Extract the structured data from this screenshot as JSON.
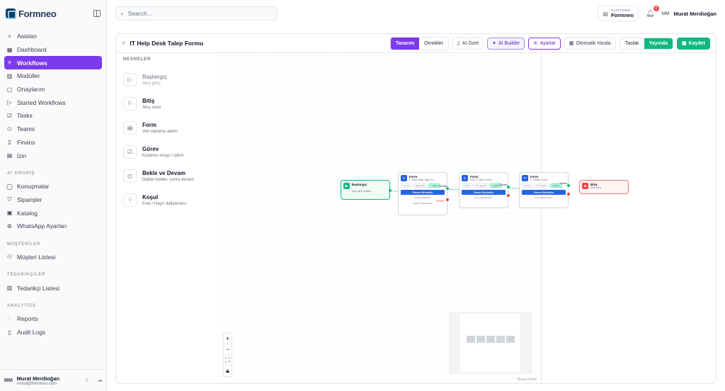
{
  "brand": {
    "name": "Formneo"
  },
  "sidebar": {
    "items": [
      {
        "label": "Asistan",
        "icon": "sparkle-icon"
      },
      {
        "label": "Dashboard",
        "icon": "grid-icon"
      },
      {
        "label": "Workflows",
        "icon": "workflow-icon",
        "active": true
      },
      {
        "label": "Modüller",
        "icon": "modules-icon"
      },
      {
        "label": "Onaylarım",
        "icon": "clipboard-icon"
      },
      {
        "label": "Started Workflows",
        "icon": "play-icon"
      },
      {
        "label": "Tasks",
        "icon": "check-square-icon"
      },
      {
        "label": "Teams",
        "icon": "users-icon"
      },
      {
        "label": "Finans",
        "icon": "file-icon"
      },
      {
        "label": "İzin",
        "icon": "calendar-icon"
      }
    ],
    "sections": [
      {
        "title": "AI SİPARİŞ",
        "items": [
          {
            "label": "Konuşmalar",
            "icon": "chat-icon"
          },
          {
            "label": "Siparişler",
            "icon": "cart-icon"
          },
          {
            "label": "Katalog",
            "icon": "box-icon"
          },
          {
            "label": "WhatsApp Ayarları",
            "icon": "gear-icon"
          }
        ]
      },
      {
        "title": "MÜŞTERİLER",
        "items": [
          {
            "label": "Müşteri Listesi",
            "icon": "users-icon"
          }
        ]
      },
      {
        "title": "TEDARİKÇİLER",
        "items": [
          {
            "label": "Tedarikçi Listesi",
            "icon": "building-icon"
          }
        ]
      },
      {
        "title": "ANALYTICS",
        "items": [
          {
            "label": "Reports",
            "icon": "bar-chart-icon"
          },
          {
            "label": "Audit Logs",
            "icon": "file-text-icon"
          }
        ]
      }
    ],
    "user": {
      "initials": "MM",
      "name": "Murat Merdioğan",
      "email": "murat@formneo.com"
    }
  },
  "topbar": {
    "search_placeholder": "Search...",
    "platform_label": "PLATFORM",
    "platform_name": "Formneo",
    "notifications": "8",
    "user_initials": "MM",
    "user_name": "Murat Merdioğan"
  },
  "workflow": {
    "title": "IT Help Desk Talep Formu",
    "tabs": [
      "Tasarım",
      "Örnekler"
    ],
    "buttons": {
      "ai_summary": "AI Özet",
      "ai_builder": "AI Builder",
      "settings": "Ayarlar",
      "auto_align": "Otomatik Hizala",
      "draft": "Taslak",
      "published": "Yayında",
      "save": "Kaydet"
    }
  },
  "palette": {
    "title": "NESNELER",
    "items": [
      {
        "title": "Başlangıç",
        "subtitle": "Akış girişi",
        "icon": "play-icon",
        "dim": true
      },
      {
        "title": "Bitiş",
        "subtitle": "Akış sonu",
        "icon": "flag-icon"
      },
      {
        "title": "Form",
        "subtitle": "Veri toplama adımı",
        "icon": "form-icon"
      },
      {
        "title": "Görev",
        "subtitle": "Kullanıcı onayı / işlem",
        "icon": "check-square-icon"
      },
      {
        "title": "Bekle ve Devam",
        "subtitle": "Dalları bekler, sonra devam",
        "icon": "timer-icon"
      },
      {
        "title": "Koşul",
        "subtitle": "Evet / Hayır dallanması",
        "icon": "branch-icon"
      }
    ]
  },
  "nodes": {
    "start": {
      "title": "Başlangıç",
      "subtitle": "Akış girişi noktası"
    },
    "form1": {
      "title": "Form",
      "subtitle": "IT Help Desk Talep Fo...",
      "tags": [
        "1 Form",
        "Aksiyonlar",
        "Yetkililer"
      ],
      "button": "Formu Görüntüle",
      "sub": "Forma yetkilendir",
      "sub2": "Ayarlar yapılandırıldı",
      "out_label": "Gönder",
      "out_label2": "Reddet"
    },
    "form2": {
      "title": "Form",
      "subtitle": "Yeni IT Talep Formu",
      "tags": [
        "1 Form",
        "Tür Seçimi",
        "Yetkililer"
      ],
      "button": "Formu Görüntüle",
      "sub": "Form yapılandırıldı",
      "out_label": "Gönder"
    },
    "form3": {
      "title": "Form",
      "subtitle": "IT Teknik Formu",
      "tags": [
        "1 Form",
        "Tür Seçimi",
        "Yetkililer"
      ],
      "button": "Formu Görüntüle",
      "sub": "Form yapılandırıldı",
      "out_label": "Tamam"
    },
    "end": {
      "title": "Bitiş",
      "subtitle": "Akış sonu"
    }
  },
  "canvas": {
    "attribution": "React Flow"
  },
  "colors": {
    "accent": "#7c3aed",
    "success": "#10b981",
    "danger": "#ef4444",
    "form": "#2563eb"
  }
}
